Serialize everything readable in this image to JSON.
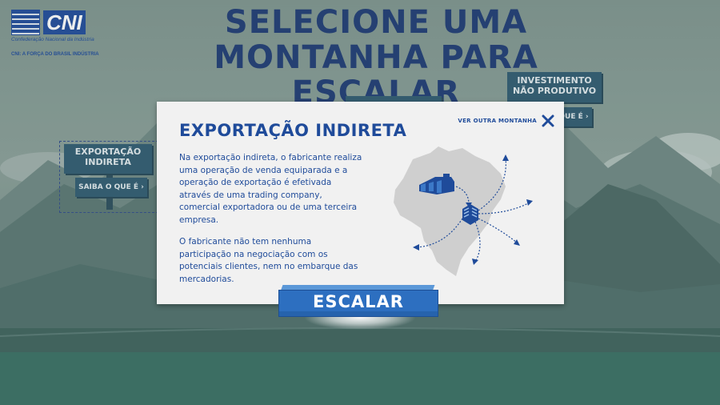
{
  "logo": {
    "wordmark": "CNI",
    "subtitle": "Confederação Nacional da Indústria",
    "tagline": "CNI: A FORÇA DO BRASIL INDÚSTRIA"
  },
  "page": {
    "title": "SELECIONE UMA MONTANHA PARA ESCALAR"
  },
  "signs": {
    "left": {
      "label_line1": "EXPORTAÇÃO",
      "label_line2": "INDIRETA",
      "button": "SAIBA O QUE É ›"
    },
    "right": {
      "label_line1": "INVESTIMENTO",
      "label_line2": "NÃO PRODUTIVO",
      "button": "QUE É ›"
    }
  },
  "modal": {
    "title": "EXPORTAÇÃO INDIRETA",
    "close_label": "VER OUTRA MONTANHA",
    "paragraph1": "Na exportação indireta, o fabricante realiza uma operação de venda equiparada e a operação de exportação é efetivada através de uma trading company, comercial exportadora ou de uma terceira empresa.",
    "paragraph2": "O fabricante não tem nenhuma participação na negociação com os potenciais clientes, nem no embarque das mercadorias."
  },
  "action": {
    "button": "ESCALAR"
  },
  "icons": {
    "close": "close-icon",
    "factory": "factory-icon",
    "trading_company": "building-icon",
    "map": "brazil-map-icon"
  },
  "colors": {
    "brand_blue": "#1f4b9a",
    "title_navy": "#1e3b73",
    "sign_teal": "#2f5b70",
    "button_blue": "#2d6fc0",
    "modal_bg": "#f1f1f1"
  }
}
